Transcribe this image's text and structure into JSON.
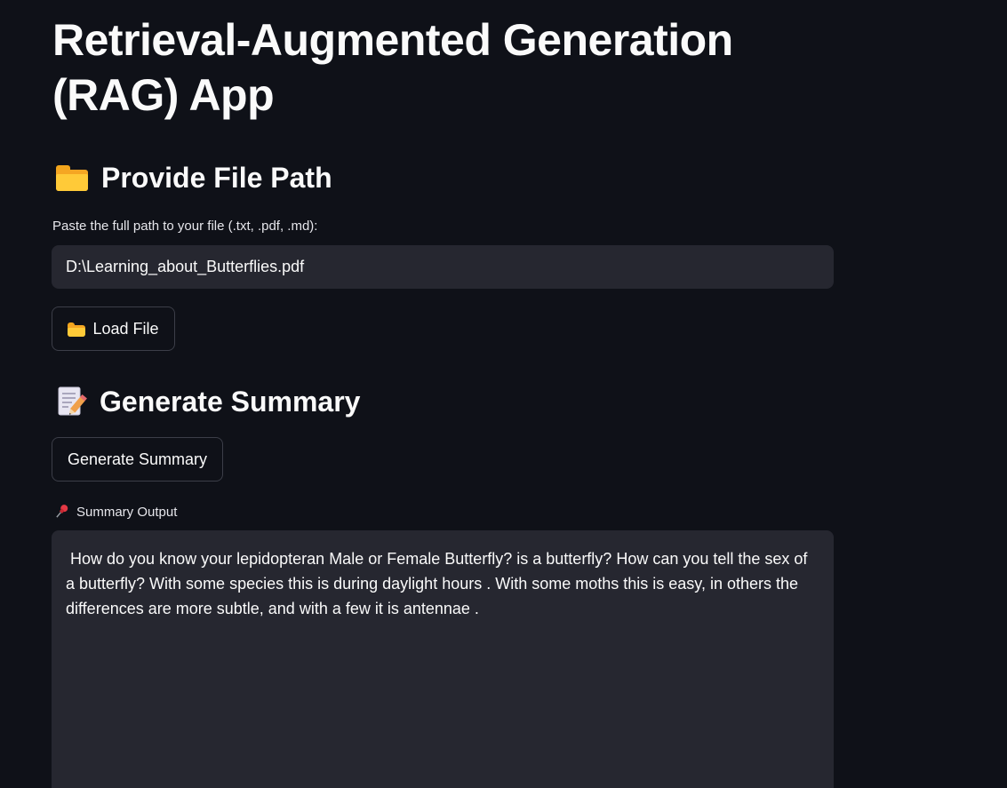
{
  "page": {
    "title": "Retrieval-Augmented Generation (RAG) App"
  },
  "file_section": {
    "heading": "Provide File Path",
    "heading_icon": "folder-icon",
    "input_label": "Paste the full path to your file (.txt, .pdf, .md):",
    "input_value": "D:\\Learning_about_Butterflies.pdf",
    "load_button_label": "Load File",
    "load_button_icon": "folder-icon"
  },
  "summary_section": {
    "heading": "Generate Summary",
    "heading_icon": "memo-icon",
    "generate_button_label": "Generate Summary",
    "output_label": "Summary Output",
    "output_label_icon": "pushpin-icon",
    "output_text": " How do you know your lepidopteran Male or Female Butterfly? is a butterfly? How can you tell the sex of a butterfly? With some species this is during daylight hours . With some moths this is easy, in others the differences are more subtle, and with a few it is antennae ."
  },
  "colors": {
    "background": "#0f1118",
    "input_background": "#262730",
    "text": "#fafafa",
    "button_border": "#3c3e48"
  }
}
